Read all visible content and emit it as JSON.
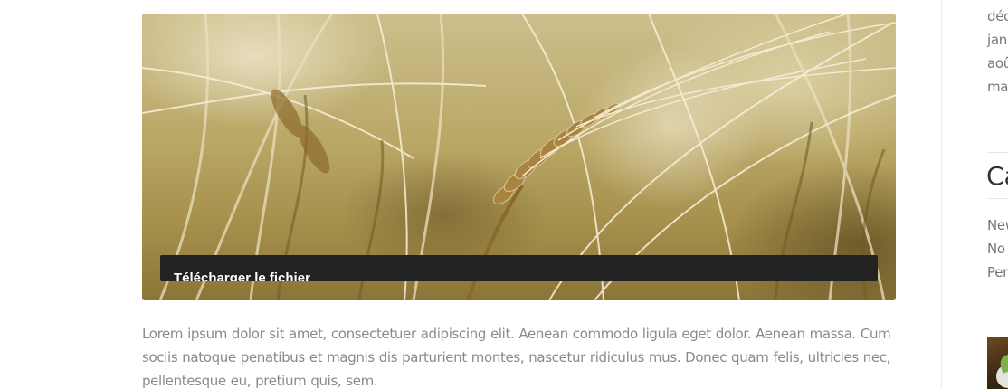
{
  "hero": {
    "download_label": "Télécharger le fichier"
  },
  "article": {
    "body": "Lorem ipsum dolor sit amet, consectetuer adipiscing elit. Aenean commodo ligula eget dolor. Aenean massa. Cum sociis natoque penatibus et magnis dis parturient montes, nascetur ridiculus mus. Donec quam felis, ultricies nec, pellentesque eu, pretium quis, sem."
  },
  "sidebar": {
    "archives": [
      "déc",
      "jan",
      "aoû",
      "ma"
    ],
    "categories_title": "Ca",
    "categories": [
      "New",
      "No",
      "Per"
    ]
  },
  "colors": {
    "download_bar": "#222222",
    "body_text": "#8a8a8a"
  },
  "icons": {
    "thumbnail": "post-thumbnail-image"
  }
}
